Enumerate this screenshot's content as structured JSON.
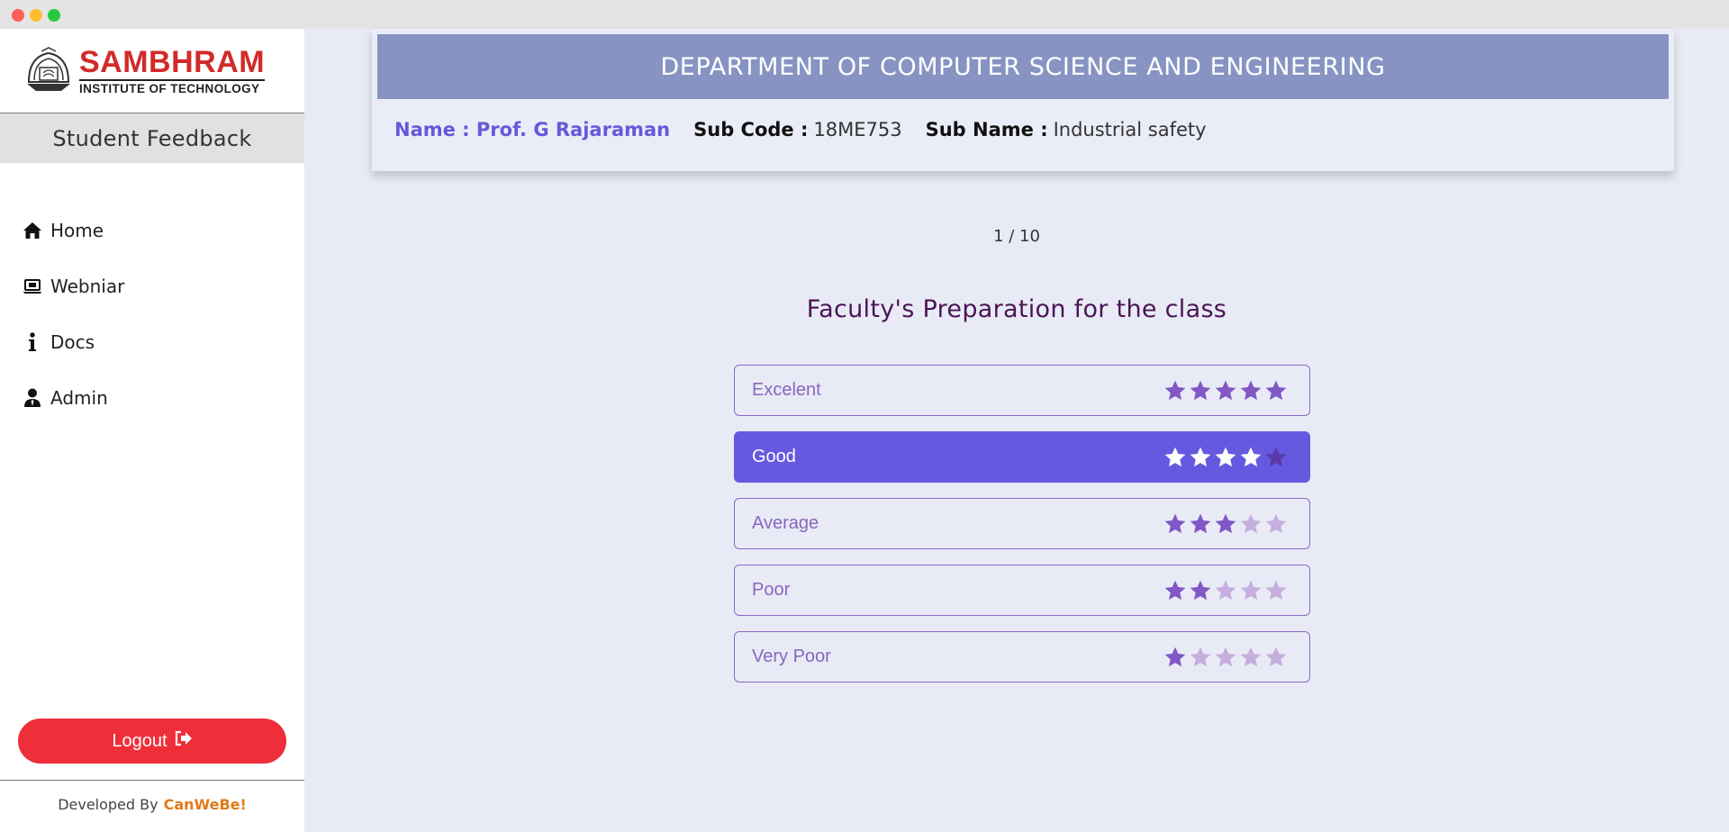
{
  "window": {
    "controls": [
      "close",
      "minimize",
      "maximize"
    ]
  },
  "sidebar": {
    "logo": {
      "main": "SAMBHRAM",
      "sub": "INSTITUTE OF TECHNOLOGY"
    },
    "title": "Student Feedback",
    "nav": [
      {
        "label": "Home",
        "icon": "home-icon"
      },
      {
        "label": "Webniar",
        "icon": "laptop-icon"
      },
      {
        "label": "Docs",
        "icon": "info-icon"
      },
      {
        "label": "Admin",
        "icon": "user-tie-icon"
      }
    ],
    "logout_label": "Logout",
    "logout_icon": "sign-out-icon",
    "footer": {
      "prefix": "Developed  By",
      "brand": "CanWeBe!"
    }
  },
  "header": {
    "department": "DEPARTMENT OF COMPUTER SCIENCE AND ENGINEERING",
    "name": "Name : Prof. G Rajaraman",
    "sub_code_label": "Sub Code :",
    "sub_code": "18ME753",
    "sub_name_label": "Sub Name :",
    "sub_name": "Industrial safety"
  },
  "question": {
    "progress": "1 / 10",
    "text": "Faculty's Preparation for the class"
  },
  "options": [
    {
      "label": "Excelent",
      "stars": 5,
      "selected": false
    },
    {
      "label": "Good",
      "stars": 4,
      "selected": true
    },
    {
      "label": "Average",
      "stars": 3,
      "selected": false
    },
    {
      "label": "Poor",
      "stars": 2,
      "selected": false
    },
    {
      "label": "Very Poor",
      "stars": 1,
      "selected": false
    }
  ],
  "colors": {
    "accent": "#6559e0",
    "dept_bar": "#8794c3",
    "logout": "#ee2e38",
    "star_filled": "#8257c6",
    "star_empty": "#c6aedf",
    "star_selected_filled": "#ffffff",
    "star_selected_empty": "#5a3aa8",
    "brand": "#e07a1a"
  }
}
